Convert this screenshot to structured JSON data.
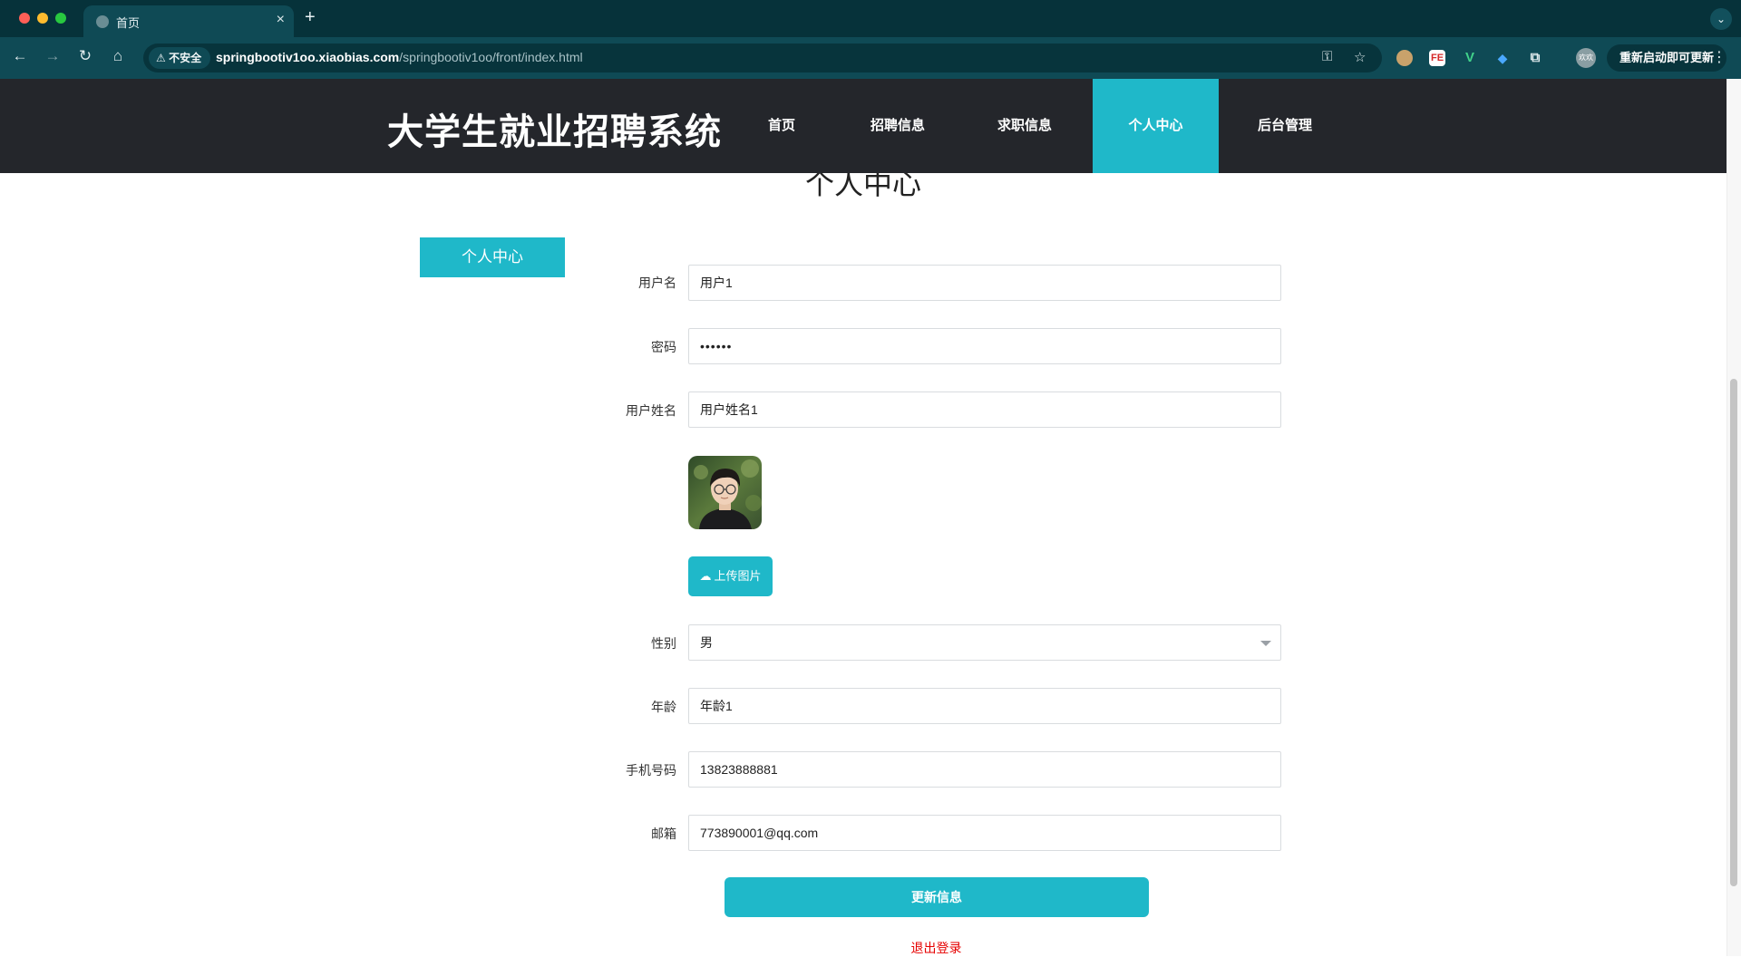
{
  "browser": {
    "tab_title": "首页",
    "tab_close": "×",
    "new_tab": "+",
    "security_label": "不安全",
    "url_host": "springbootiv1oo.xiaobias.com",
    "url_path": "/springbootiv1oo/front/index.html",
    "profile_initials": "欢欢",
    "update_label": "重新启动即可更新",
    "ext_fe": "FE",
    "ext_v": "V"
  },
  "site": {
    "title": "大学生就业招聘系统",
    "nav": [
      {
        "label": "首页",
        "active": false
      },
      {
        "label": "招聘信息",
        "active": false
      },
      {
        "label": "求职信息",
        "active": false
      },
      {
        "label": "个人中心",
        "active": true
      },
      {
        "label": "后台管理",
        "active": false
      }
    ]
  },
  "page": {
    "heading": "个人中心",
    "side_button": "个人中心"
  },
  "form": {
    "username": {
      "label": "用户名",
      "value": "用户1"
    },
    "password": {
      "label": "密码",
      "value": "••••••"
    },
    "realname": {
      "label": "用户姓名",
      "value": "用户姓名1"
    },
    "upload_label": "上传图片",
    "gender": {
      "label": "性别",
      "value": "男"
    },
    "age": {
      "label": "年龄",
      "value": "年龄1"
    },
    "phone": {
      "label": "手机号码",
      "value": "13823888881"
    },
    "email": {
      "label": "邮箱",
      "value": "773890001@qq.com"
    },
    "submit_label": "更新信息",
    "logout_label": "退出登录"
  },
  "colors": {
    "accent": "#1fb8c9",
    "header_bg": "#24262b",
    "logout": "#e60000"
  }
}
